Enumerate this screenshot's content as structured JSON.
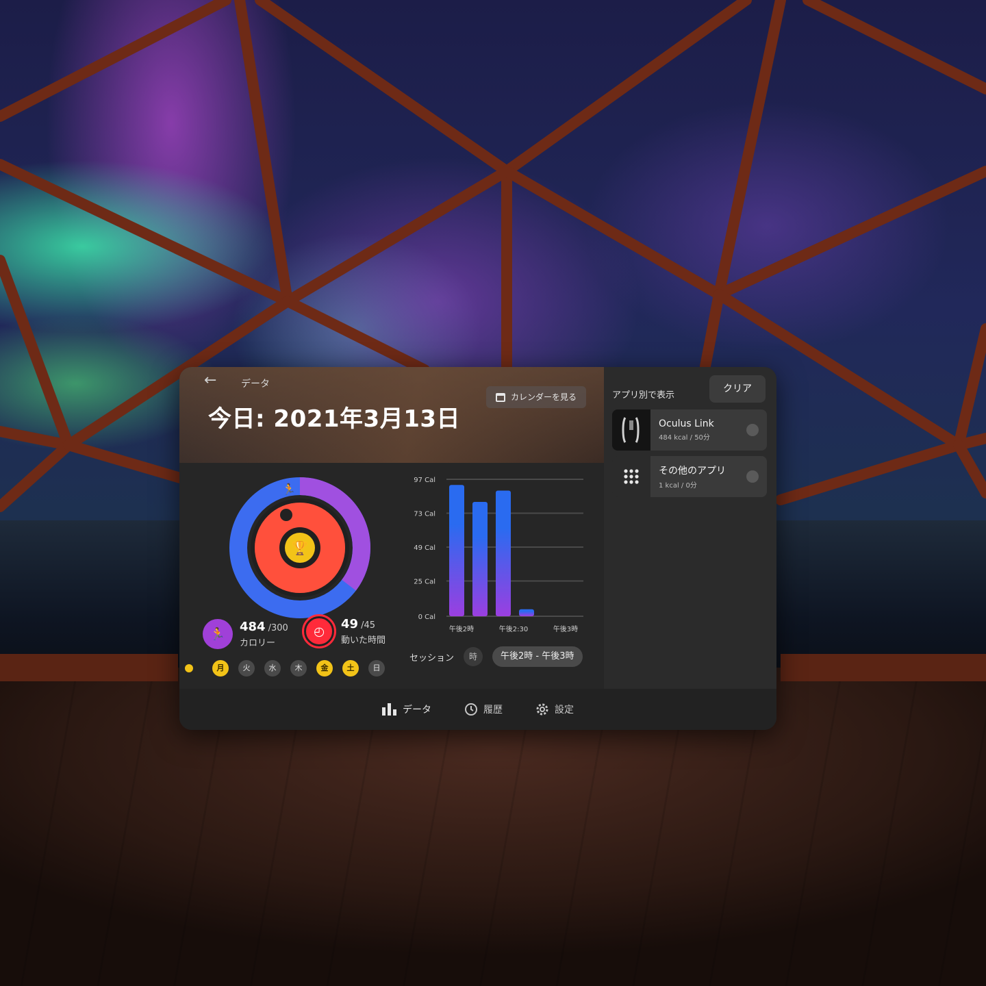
{
  "header": {
    "breadcrumb": "データ",
    "title": "今日: 2021年3月13日",
    "calendar_button": "カレンダーを見る",
    "back_icon": "arrow-left-icon"
  },
  "activity": {
    "calories": {
      "value": "484",
      "goal": "/300",
      "label": "カロリー"
    },
    "minutes": {
      "value": "49",
      "goal": "/45",
      "label": "動いた時間"
    },
    "ring_colors": {
      "outer": "#3c6cf0",
      "outer_accent": "#a050e0",
      "inner": "#ff3b3b",
      "center": "#f2c318"
    }
  },
  "week": {
    "days": [
      {
        "label": "月",
        "done": true
      },
      {
        "label": "火",
        "done": false
      },
      {
        "label": "水",
        "done": false
      },
      {
        "label": "木",
        "done": false
      },
      {
        "label": "金",
        "done": true
      },
      {
        "label": "土",
        "done": true
      },
      {
        "label": "日",
        "done": false
      }
    ]
  },
  "chart_data": {
    "type": "bar",
    "y_ticks": [
      "97 Cal",
      "73 Cal",
      "49 Cal",
      "25 Cal",
      "0 Cal"
    ],
    "y_tick_values": [
      97,
      73,
      49,
      25,
      0
    ],
    "ylim": [
      0,
      97
    ],
    "x_ticks": [
      "午後2時",
      "午後2:30",
      "午後3時"
    ],
    "values": [
      93,
      81,
      89,
      5
    ],
    "bar_gradient": [
      "#2a6bf0",
      "#9b3fe0"
    ]
  },
  "session": {
    "label": "セッション",
    "chip": "時",
    "range": "午後2時 - 午後3時"
  },
  "apps": {
    "filter_label": "アプリ別で表示",
    "clear_button": "クリア",
    "items": [
      {
        "name": "Oculus Link",
        "meta": "484 kcal / 50分",
        "icon": "oculus-link-icon"
      },
      {
        "name": "その他のアプリ",
        "meta": "1 kcal / 0分",
        "icon": "grid-icon"
      }
    ]
  },
  "nav": {
    "data": "データ",
    "history": "履歴",
    "settings": "設定"
  }
}
